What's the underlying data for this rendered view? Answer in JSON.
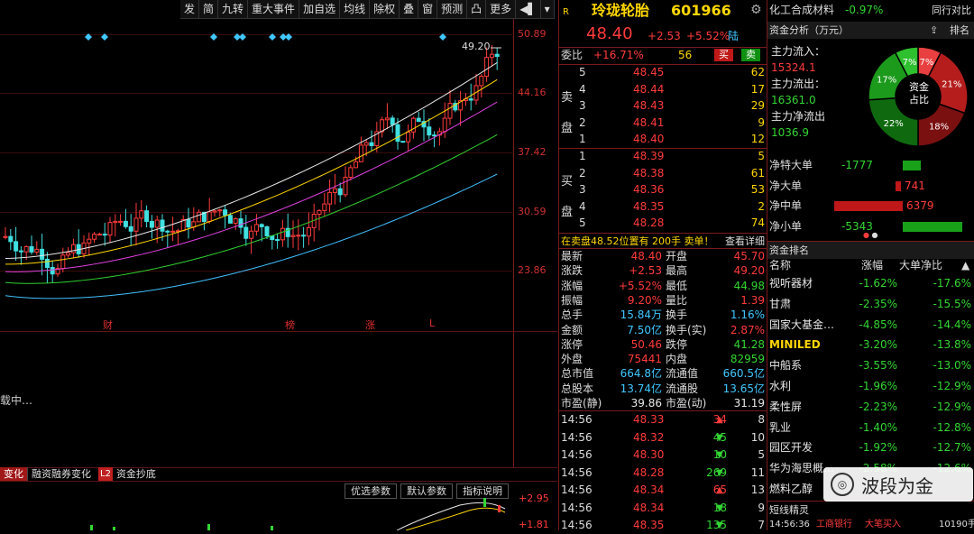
{
  "toolbar": {
    "items": [
      "发",
      "简",
      "九转",
      "重大事件",
      "加自选",
      "均线",
      "除权",
      "叠",
      "窗",
      "预测",
      "凸",
      "更多",
      "◀▌",
      "▾"
    ]
  },
  "chart": {
    "price_levels": [
      "50.89",
      "44.16",
      "37.42",
      "30.59",
      "23.86"
    ],
    "marker_label": "49.20",
    "bottom_markers": [
      "财",
      "榜",
      "涨",
      "L"
    ],
    "loading_text": "载中…",
    "bottom_tabs": [
      "变化",
      "融资融券变化",
      "资金抄底"
    ],
    "bottom_tab_badge": "L2",
    "indicator_buttons": [
      "优选参数",
      "默认参数",
      "指标说明"
    ],
    "indicator_values": [
      "+2.95",
      "+1.81"
    ]
  },
  "stock": {
    "badge": "R",
    "name": "玲珑轮胎",
    "code": "601966",
    "price": "48.40",
    "change": "+2.53",
    "change_pct": "+5.52%",
    "flag": "陆"
  },
  "orderbook": {
    "wb_label": "委比",
    "wb_value": "+16.71%",
    "wb_diff": "56",
    "sell_btn": "买",
    "buy_btn": "卖",
    "sell_side_label": [
      "卖",
      "盘"
    ],
    "buy_side_label": [
      "买",
      "盘"
    ],
    "sells": [
      [
        "5",
        "48.45",
        "62"
      ],
      [
        "4",
        "48.44",
        "17"
      ],
      [
        "3",
        "48.43",
        "29"
      ],
      [
        "2",
        "48.41",
        "9"
      ],
      [
        "1",
        "48.40",
        "12"
      ]
    ],
    "buys": [
      [
        "1",
        "48.39",
        "5"
      ],
      [
        "2",
        "48.38",
        "61"
      ],
      [
        "3",
        "48.36",
        "53"
      ],
      [
        "4",
        "48.35",
        "2"
      ],
      [
        "5",
        "48.28",
        "74"
      ]
    ]
  },
  "notice": {
    "text": "在卖盘48.52位置有 200手 卖单！",
    "link": "查看详细"
  },
  "stats": [
    [
      "最新",
      "48.40",
      "开盘",
      "45.70"
    ],
    [
      "涨跌",
      "+2.53",
      "最高",
      "49.20"
    ],
    [
      "涨幅",
      "+5.52%",
      "最低",
      "44.98"
    ],
    [
      "振幅",
      "9.20%",
      "量比",
      "1.39"
    ],
    [
      "总手",
      "15.84万",
      "换手",
      "1.16%"
    ],
    [
      "金额",
      "7.50亿",
      "换手(实)",
      "2.87%"
    ],
    [
      "涨停",
      "50.46",
      "跌停",
      "41.28"
    ],
    [
      "外盘",
      "75441",
      "内盘",
      "82959"
    ],
    [
      "总市值",
      "664.8亿",
      "流通值",
      "660.5亿"
    ],
    [
      "总股本",
      "13.74亿",
      "流通股",
      "13.65亿"
    ],
    [
      "市盈(静)",
      "39.86",
      "市盈(动)",
      "31.19"
    ]
  ],
  "ticks": [
    [
      "14:56",
      "48.33",
      "34",
      "up",
      "8"
    ],
    [
      "14:56",
      "48.32",
      "45",
      "dn",
      "10"
    ],
    [
      "14:56",
      "48.30",
      "10",
      "dn",
      "5"
    ],
    [
      "14:56",
      "48.28",
      "269",
      "dn",
      "11"
    ],
    [
      "14:56",
      "48.34",
      "65",
      "up",
      "13"
    ],
    [
      "14:56",
      "48.34",
      "18",
      "dn",
      "9"
    ],
    [
      "14:56",
      "48.35",
      "135",
      "dn",
      "7"
    ]
  ],
  "sidebar": {
    "sector": "化工合成材料",
    "sector_pct": "-0.97%",
    "sector_link": "同行对比",
    "fund_title": "资金分析（万元）",
    "fund_rank": "排名",
    "inflow_label": "主力流入：",
    "inflow": "15324.1",
    "outflow_label": "主力流出：",
    "outflow": "16361.0",
    "net_label": "主力净流出",
    "net": "1036.9",
    "pie_center": [
      "资金",
      "占比"
    ],
    "pie_labels": [
      "7%",
      "7%",
      "21%",
      "18%",
      "22%",
      "17%"
    ],
    "flows": [
      [
        "净特大单",
        "-1777"
      ],
      [
        "净大单",
        "741"
      ],
      [
        "净中单",
        "6379"
      ],
      [
        "净小单",
        "-5343"
      ]
    ],
    "rank_title": "资金排名",
    "rank_headers": [
      "名称",
      "涨幅",
      "大单净比"
    ],
    "ranks": [
      [
        "视听器材",
        "-1.62%",
        "-17.6%"
      ],
      [
        "甘肃",
        "-2.35%",
        "-15.5%"
      ],
      [
        "国家大基金…",
        "-4.85%",
        "-14.4%"
      ],
      [
        "MINILED",
        "-3.20%",
        "-13.8%"
      ],
      [
        "中船系",
        "-3.55%",
        "-13.0%"
      ],
      [
        "水利",
        "-1.96%",
        "-12.9%"
      ],
      [
        "柔性屏",
        "-2.23%",
        "-12.9%"
      ],
      [
        "乳业",
        "-1.40%",
        "-12.8%"
      ],
      [
        "园区开发",
        "-1.92%",
        "-12.7%"
      ],
      [
        "华为海思概…",
        "-2.58%",
        "-12.6%"
      ],
      [
        "燃料乙醇",
        "",
        ""
      ]
    ],
    "short_title": "短线精灵",
    "short_row": [
      "14:56:36",
      "工商银行",
      "大笔买入",
      "10190手"
    ],
    "watermark": "波段为金"
  },
  "chart_data": {
    "type": "candlestick",
    "ylim": [
      23.86,
      50.89
    ],
    "y_ticks": [
      "50.89",
      "44.16",
      "37.42",
      "30.59",
      "23.86"
    ],
    "high_label": "49.20"
  }
}
